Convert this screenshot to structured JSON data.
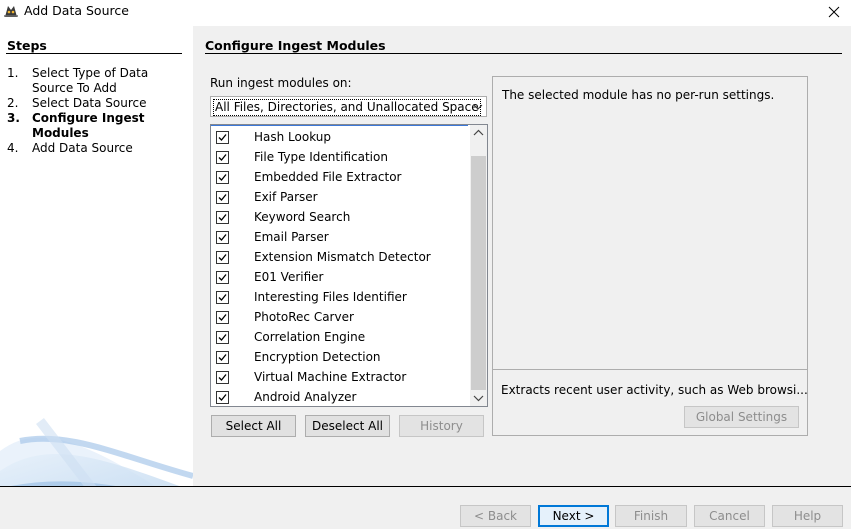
{
  "window": {
    "title": "Add Data Source"
  },
  "steps": {
    "heading": "Steps",
    "items": [
      {
        "num": "1.",
        "label": "Select Type of Data Source To Add",
        "active": false
      },
      {
        "num": "2.",
        "label": "Select Data Source",
        "active": false
      },
      {
        "num": "3.",
        "label": "Configure Ingest Modules",
        "active": true
      },
      {
        "num": "4.",
        "label": "Add Data Source",
        "active": false
      }
    ]
  },
  "configure": {
    "heading": "Configure Ingest Modules",
    "run_label": "Run ingest modules on:",
    "run_selected": "All Files, Directories, and Unallocated Space",
    "modules": [
      {
        "label": "Hash Lookup",
        "checked": true
      },
      {
        "label": "File Type Identification",
        "checked": true
      },
      {
        "label": "Embedded File Extractor",
        "checked": true
      },
      {
        "label": "Exif Parser",
        "checked": true
      },
      {
        "label": "Keyword Search",
        "checked": true
      },
      {
        "label": "Email Parser",
        "checked": true
      },
      {
        "label": "Extension Mismatch Detector",
        "checked": true
      },
      {
        "label": "E01 Verifier",
        "checked": true
      },
      {
        "label": "Interesting Files Identifier",
        "checked": true
      },
      {
        "label": "PhotoRec Carver",
        "checked": true
      },
      {
        "label": "Correlation Engine",
        "checked": true
      },
      {
        "label": "Encryption Detection",
        "checked": true
      },
      {
        "label": "Virtual Machine Extractor",
        "checked": true
      },
      {
        "label": "Android Analyzer",
        "checked": true
      }
    ],
    "select_all": "Select All",
    "deselect_all": "Deselect All",
    "history": "History",
    "settings_message": "The selected module has no per-run settings.",
    "module_description": "Extracts recent user activity, such as Web browsi...",
    "global_settings": "Global Settings"
  },
  "footer": {
    "back": "< Back",
    "next": "Next >",
    "finish": "Finish",
    "cancel": "Cancel",
    "help": "Help"
  },
  "colors": {
    "panel_bg": "#f0f0f0",
    "accent": "#0078d7"
  }
}
